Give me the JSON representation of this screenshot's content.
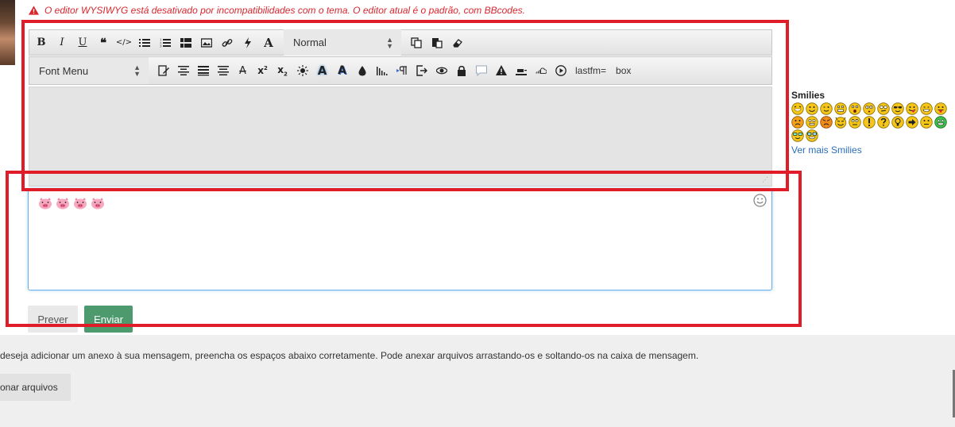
{
  "warning": {
    "text": "O editor WYSIWYG está desativado por incompatibilidades com o tema. O editor atual é o padrão, com BBcodes."
  },
  "toolbar": {
    "row1": {
      "bold": "B",
      "italic": "I",
      "underline": "U",
      "quote": "❝",
      "code": "</>",
      "format_select": "Normal"
    },
    "row2": {
      "font_select": "Font Menu",
      "lastfm": "lastfm=",
      "box": "box"
    }
  },
  "editor": {
    "content_icons": [
      "pig-face-icon",
      "pig-face-icon",
      "pig-face-icon",
      "pig-face-icon"
    ]
  },
  "buttons": {
    "prever": "Prever",
    "enviar": "Enviar"
  },
  "smilies": {
    "title": "Smilies",
    "more_link": "Ver mais Smilies"
  },
  "attachments": {
    "info": "deseja adicionar um anexo à sua mensagem, preencha os espaços abaixo corretamente. Pode anexar arquivos arrastando-os e soltando-os na caixa de mensagem.",
    "add_button": "onar arquivos"
  },
  "colors": {
    "highlight": "#e01c28",
    "warning": "#d9272e",
    "send": "#4e9a6f",
    "link": "#2a6ebb",
    "focus": "#66afe9"
  }
}
